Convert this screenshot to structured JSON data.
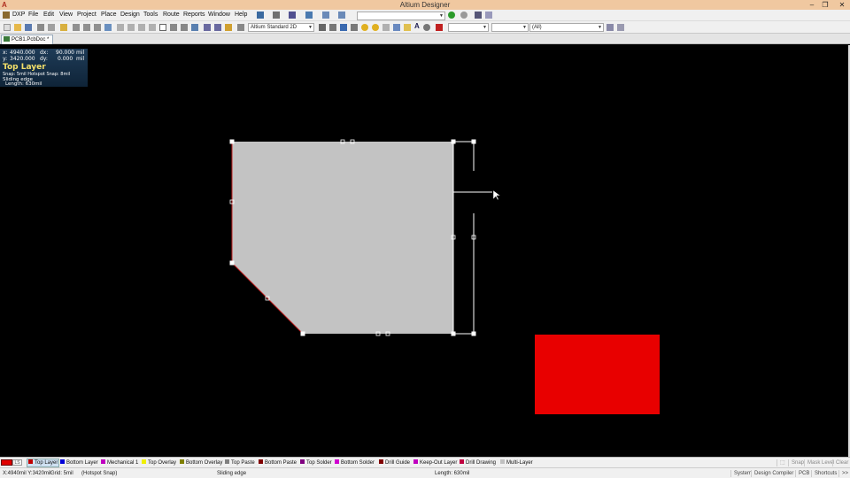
{
  "window": {
    "title": "Altium Designer",
    "app_icon": "A",
    "min_symbol": "–",
    "max_symbol": "❐",
    "close_symbol": "✕"
  },
  "menu": {
    "items": [
      "DXP",
      "File",
      "Edit",
      "View",
      "Project",
      "Place",
      "Design",
      "Tools",
      "Route",
      "Reports",
      "Window",
      "Help"
    ]
  },
  "toolbar": {
    "view_config": "Altium Standard 2D",
    "filter_combo": "(All)"
  },
  "document": {
    "tab_label": "PCB1.PcbDoc *"
  },
  "hud": {
    "x_label": "x:",
    "x_value": "4940.000",
    "dx_label": "dx:",
    "dx_value": "90.000",
    "dx_unit": "mil",
    "y_label": "y:",
    "y_value": "3420.000",
    "dy_label": "dy:",
    "dy_value": "0.000",
    "dy_unit": "mil",
    "layer": "Top Layer",
    "snap": "Snap: 5mil Hotspot Snap: 8mil",
    "mode": "Sliding edge",
    "length": "Length: 630mil"
  },
  "colors": {
    "polygon_fill": "#c3c3c3",
    "pad_fill": "#e80000",
    "top_layer": "#c00000",
    "bottom_layer": "#0000d8",
    "mechanical_1": "#c000c0",
    "top_overlay": "#f0f000",
    "bottom_overlay": "#808000",
    "top_paste": "#808080",
    "bottom_paste": "#800000",
    "top_solder": "#800080",
    "bottom_solder": "#d000d0",
    "drill_guide": "#800000",
    "keep_out": "#c000c0",
    "drill_drawing": "#c00040",
    "multi_layer": "#c0c0c0"
  },
  "layers": [
    {
      "name": "Top Layer",
      "key": "top_layer",
      "active": true
    },
    {
      "name": "Bottom Layer",
      "key": "bottom_layer"
    },
    {
      "name": "Mechanical 1",
      "key": "mechanical_1"
    },
    {
      "name": "Top Overlay",
      "key": "top_overlay"
    },
    {
      "name": "Bottom Overlay",
      "key": "bottom_overlay"
    },
    {
      "name": "Top Paste",
      "key": "top_paste"
    },
    {
      "name": "Bottom Paste",
      "key": "bottom_paste"
    },
    {
      "name": "Top Solder",
      "key": "top_solder"
    },
    {
      "name": "Bottom Solder",
      "key": "bottom_solder"
    },
    {
      "name": "Drill Guide",
      "key": "drill_guide"
    },
    {
      "name": "Keep-Out Layer",
      "key": "keep_out"
    },
    {
      "name": "Drill Drawing",
      "key": "drill_drawing"
    },
    {
      "name": "Multi-Layer",
      "key": "multi_layer"
    }
  ],
  "layerbar_right": {
    "ls_label": "LS",
    "snap": "Snap",
    "mask_level": "Mask Level",
    "clear": "Clear"
  },
  "status": {
    "coords": "X:4940mil Y:3420mil",
    "grid": "Grid: 5mil",
    "snap_mode": "(Hotspot Snap)",
    "mode": "Sliding edge",
    "length": "Length: 630mil",
    "panels": [
      "System",
      "Design Compiler",
      "PCB",
      "Shortcuts",
      ">>"
    ]
  }
}
